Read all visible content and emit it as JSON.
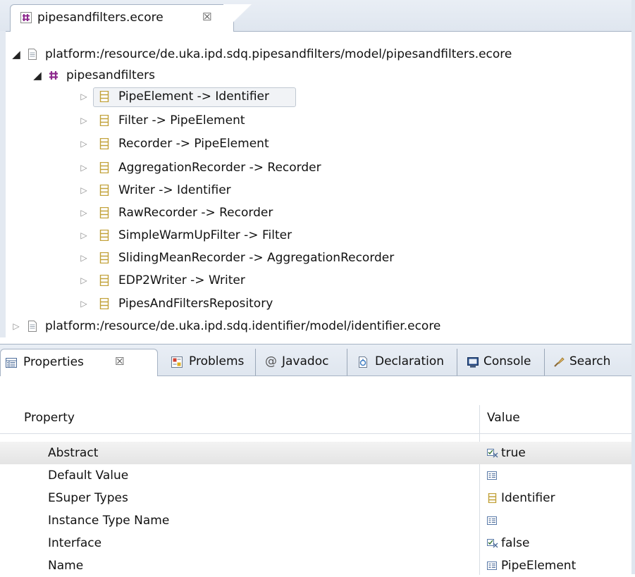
{
  "editor": {
    "tab": {
      "label": "pipesandfilters.ecore",
      "close_glyph": "☒",
      "icon": "ecore-package-icon"
    },
    "tree": {
      "root_resource": "platform:/resource/de.uka.ipd.sdq.pipesandfilters/model/pipesandfilters.ecore",
      "package": "pipesandfilters",
      "classes": [
        "PipeElement -> Identifier",
        "Filter -> PipeElement",
        "Recorder -> PipeElement",
        "AggregationRecorder -> Recorder",
        "Writer -> Identifier",
        "RawRecorder -> Recorder",
        "SimpleWarmUpFilter -> Filter",
        "SlidingMeanRecorder -> AggregationRecorder",
        "EDP2Writer -> Writer",
        "PipesAndFiltersRepository"
      ],
      "second_resource": "platform:/resource/de.uka.ipd.sdq.identifier/model/identifier.ecore"
    }
  },
  "views": {
    "tabs": [
      {
        "label": "Properties",
        "close_glyph": "☒",
        "icon": "properties-icon"
      },
      {
        "label": "Problems",
        "icon": "problems-icon"
      },
      {
        "label": "Javadoc",
        "icon": "javadoc-icon"
      },
      {
        "label": "Declaration",
        "icon": "declaration-icon"
      },
      {
        "label": "Console",
        "icon": "console-icon"
      },
      {
        "label": "Search",
        "icon": "search-icon"
      }
    ],
    "javadoc_glyph": "@",
    "table": {
      "headers": {
        "property": "Property",
        "value": "Value"
      },
      "rows": [
        {
          "property": "Abstract",
          "value": "true"
        },
        {
          "property": "Default Value",
          "value": ""
        },
        {
          "property": "ESuper Types",
          "value": "Identifier"
        },
        {
          "property": "Instance Type Name",
          "value": ""
        },
        {
          "property": "Interface",
          "value": "false"
        },
        {
          "property": "Name",
          "value": "PipeElement"
        }
      ]
    }
  },
  "colors": {
    "class_icon": "#c2a23a",
    "package_icon": "#8e2a8e",
    "tab_border": "#a6b3c4",
    "tab_bg": "#e3e9f1"
  }
}
